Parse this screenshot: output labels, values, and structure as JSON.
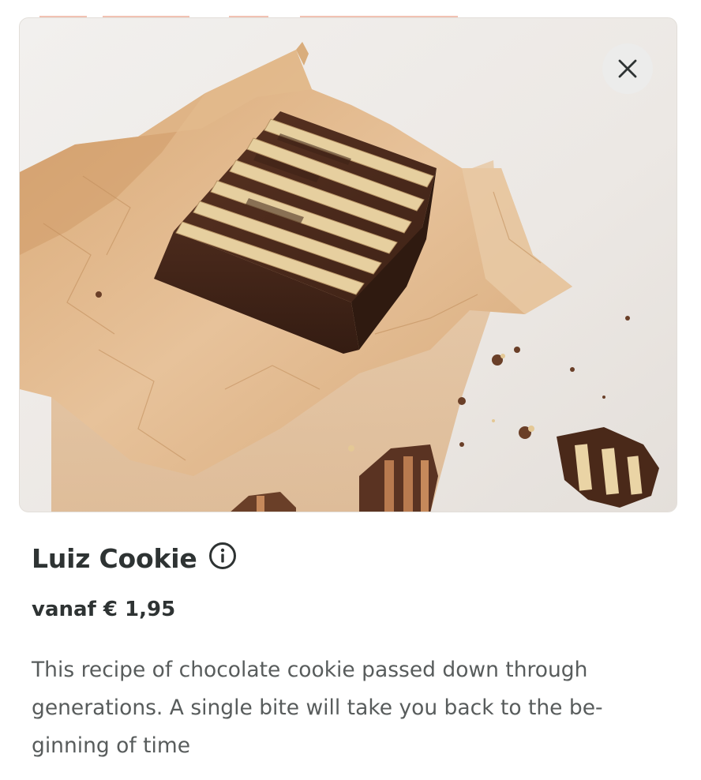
{
  "product": {
    "name": "Luiz Cookie",
    "price_label": "vanaf € 1,95",
    "description": "This recipe of chocolate cookie passed down through generations. A single bite will take you back to the be-ginning of time",
    "image_alt": "Chocolate biscuit cake slice on crinkled parchment paper"
  },
  "icons": {
    "close": "close-icon",
    "info": "info-circle-icon"
  },
  "colors": {
    "text_primary": "#2e3333",
    "text_secondary": "#585c5c",
    "close_bg": "#ececec",
    "peek_accent": "#e8563a"
  }
}
